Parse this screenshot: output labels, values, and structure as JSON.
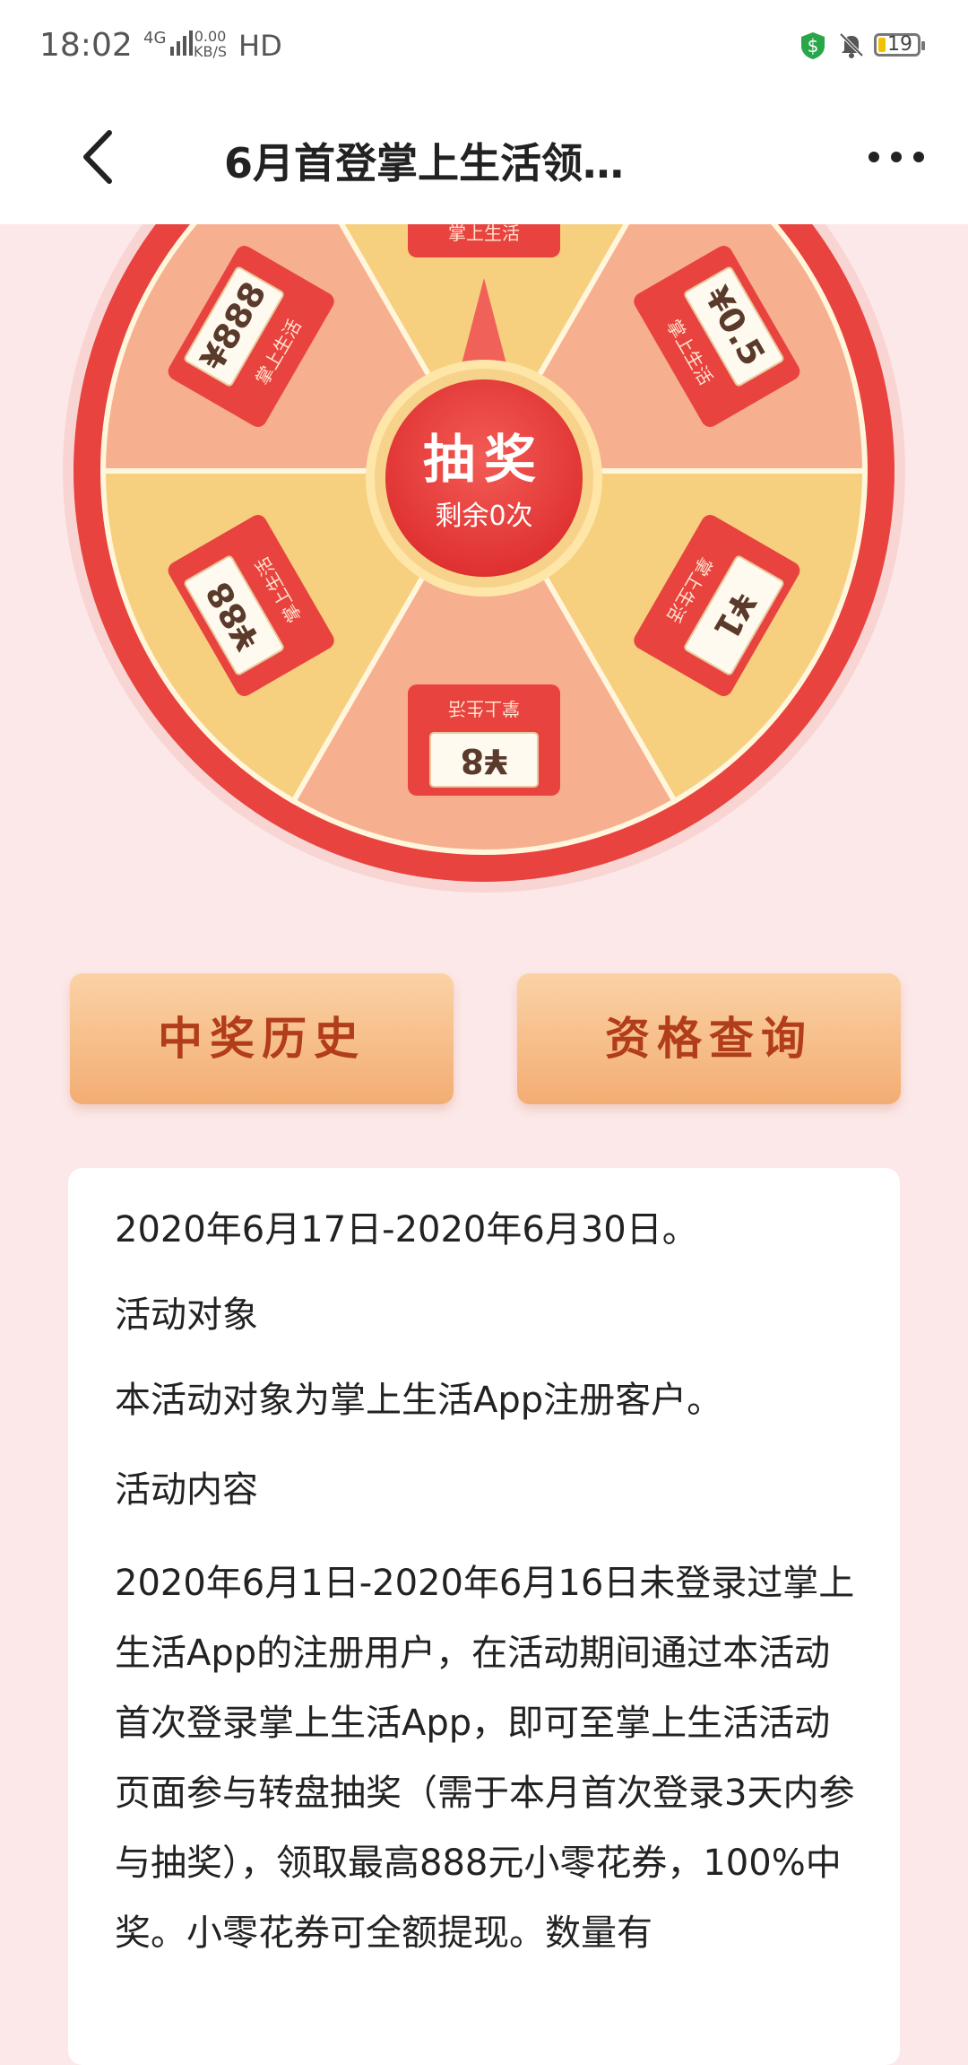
{
  "status_bar": {
    "time": "18:02",
    "network": "4G",
    "speed_value": "0.00",
    "speed_unit": "KB/S",
    "hd": "HD",
    "battery": "19"
  },
  "nav": {
    "title": "6月首登掌上生活领…"
  },
  "wheel": {
    "draw_label": "抽奖",
    "remaining_label": "剩余0次",
    "prizes": [
      "888",
      "0.5",
      "1",
      "8",
      "88",
      "888"
    ],
    "brand_on_envelopes": "掌上生活",
    "currency_symbol": "¥"
  },
  "buttons": {
    "history": "中奖历史",
    "qualification": "资格查询"
  },
  "info": {
    "date_range": "2020年6月17日-2020年6月30日。",
    "target_heading": "活动对象",
    "target_text": "本活动对象为掌上生活App注册客户。",
    "content_heading": "活动内容",
    "content_text": "2020年6月1日-2020年6月16日未登录过掌上生活App的注册用户，在活动期间通过本活动首次登录掌上生活App，即可至掌上生活活动页面参与转盘抽奖（需于本月首次登录3天内参与抽奖），领取最高888元小零花券，100%中奖。小零花券可全额提现。数量有"
  },
  "colors": {
    "accent_red": "#e8433f",
    "wheel_rim": "#f06a5a",
    "slice_peach": "#f7b08f",
    "slice_yellow": "#f6d07e",
    "button_text": "#b23d1a",
    "page_bg": "#fce8e8"
  },
  "icons": [
    "back-arrow-icon",
    "more-dots-icon",
    "shield-dollar-icon",
    "bell-muted-icon",
    "battery-icon",
    "signal-icon"
  ]
}
